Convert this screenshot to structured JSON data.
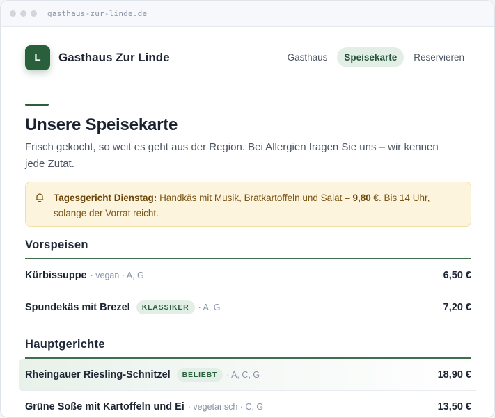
{
  "browser": {
    "url": "gasthaus-zur-linde.de"
  },
  "header": {
    "logo_letter": "L",
    "brand": "Gasthaus Zur Linde",
    "nav": [
      {
        "label": "Gasthaus",
        "active": false
      },
      {
        "label": "Speisekarte",
        "active": true
      },
      {
        "label": "Reservieren",
        "active": false
      }
    ]
  },
  "hero": {
    "title": "Unsere Speisekarte",
    "subtitle": "Frisch gekocht, so weit es geht aus der Region. Bei Allergien fragen Sie uns – wir kennen jede Zutat."
  },
  "notice": {
    "icon": "bell-icon",
    "label": "Tagesgericht Dienstag:",
    "text": "Handkäs mit Musik, Bratkartoffeln und Salat –",
    "price": "9,80 €",
    "rest": ". Bis 14 Uhr, solange der Vorrat reicht."
  },
  "sections": [
    {
      "title": "Vorspeisen",
      "items": [
        {
          "name": "Kürbissuppe",
          "meta": "· vegan · A, G",
          "price": "6,50 €"
        },
        {
          "name": "Spundekäs mit Brezel",
          "badge": "KLASSIKER",
          "meta": "· A, G",
          "price": "7,20 €"
        }
      ]
    },
    {
      "title": "Hauptgerichte",
      "items": [
        {
          "name": "Rheingauer Riesling-Schnitzel",
          "badge": "BELIEBT",
          "meta": "· A, C, G",
          "price": "18,90 €"
        },
        {
          "name": "Grüne Soße mit Kartoffeln und Ei",
          "meta": "· vegetarisch · C, G",
          "price": "13,50 €"
        }
      ]
    }
  ],
  "colors": {
    "accent": "#2a5f3c",
    "notice_bg": "#fdf4de",
    "badge_bg": "#e3efe6"
  }
}
